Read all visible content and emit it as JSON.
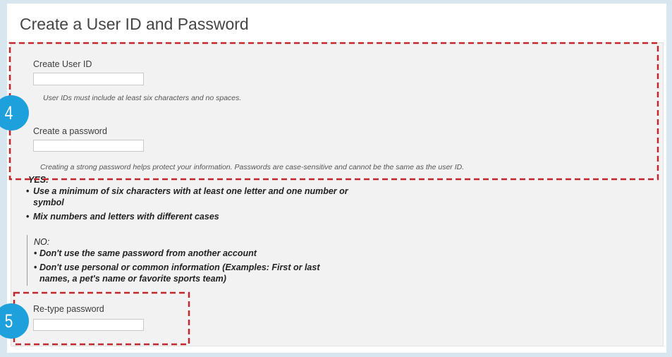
{
  "page": {
    "title": "Create a User ID and Password"
  },
  "step_markers": [
    "4",
    "5"
  ],
  "user_id": {
    "label": "Create User ID",
    "value": "",
    "help": "User IDs must include at least six characters and no spaces."
  },
  "password": {
    "label": "Create a password",
    "value": "",
    "help": "Creating a strong password helps protect your information. Passwords are case-sensitive and cannot be the same as the user ID."
  },
  "guidelines": {
    "yes_heading": "YES:",
    "yes_items": [
      "Use a minimum of six characters with at least one letter and one number or symbol",
      "Mix numbers and letters with different cases"
    ],
    "no_heading": "NO:",
    "no_items": [
      "Don't use the same password from another account",
      "Don't use personal or common information (Examples: First or last names, a pet's name or favorite sports team)"
    ]
  },
  "retype_password": {
    "label": "Re-type password",
    "value": ""
  },
  "colors": {
    "step_marker": "#1ea0dc",
    "highlight_dashes": "#c1272d",
    "panel_background": "#f2f2f2",
    "frame_background": "#d8e6ef",
    "text": "#333333"
  }
}
